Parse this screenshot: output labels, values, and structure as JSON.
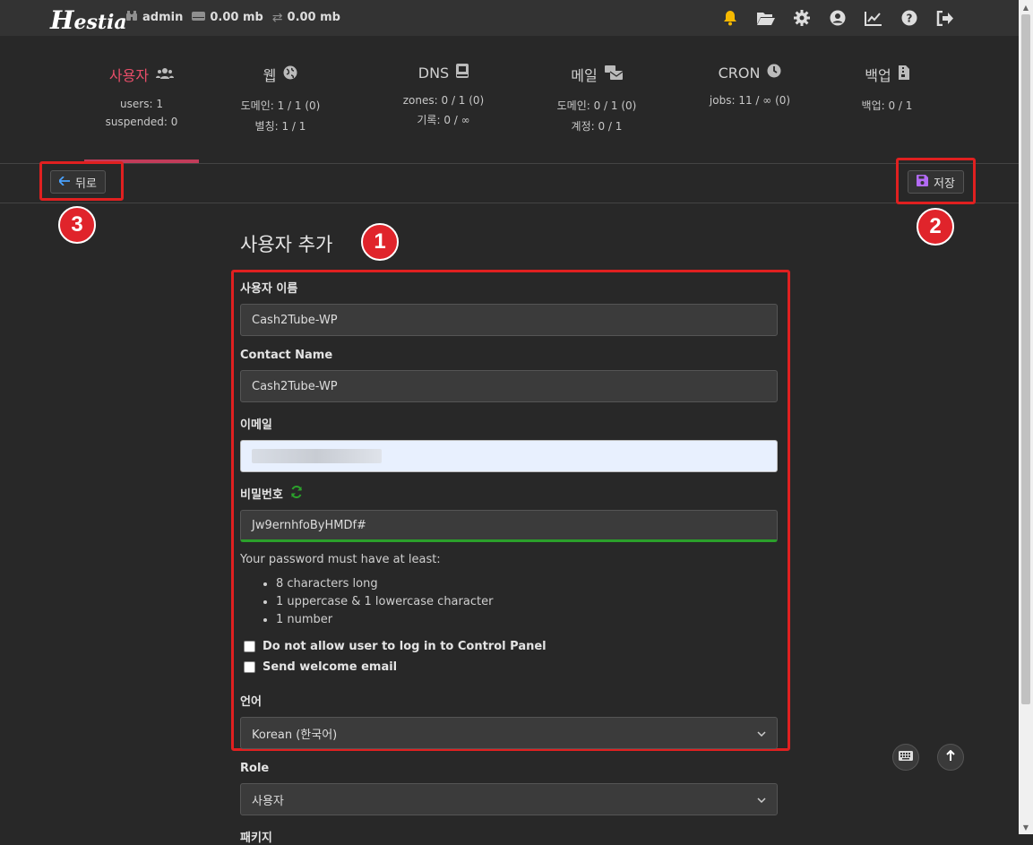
{
  "topbar": {
    "logo": "estia",
    "logo_h": "H",
    "user": "admin",
    "disk": "0.00 mb",
    "bandwidth": "0.00 mb"
  },
  "tabs": [
    {
      "title": "사용자",
      "l1": "users: 1",
      "l2": "suspended: 0",
      "icon": "users-icon"
    },
    {
      "title": "웹",
      "l1": "도메인: 1 / 1 (0)",
      "l2": "별칭: 1 / 1",
      "icon": "globe-icon"
    },
    {
      "title": "DNS",
      "l1": "zones: 0 / 1 (0)",
      "l2": "기록: 0 / ∞",
      "icon": "book-icon"
    },
    {
      "title": "메일",
      "l1": "도메인: 0 / 1 (0)",
      "l2": "계정: 0 / 1",
      "icon": "mail-bulk-icon"
    },
    {
      "title": "CRON",
      "l1": "jobs: 11 / ∞ (0)",
      "l2": "",
      "icon": "clock-icon"
    },
    {
      "title": "백업",
      "l1": "백업: 0 / 1",
      "l2": "",
      "icon": "file-archive-icon"
    }
  ],
  "toolbar": {
    "back_label": "뒤로",
    "save_label": "저장"
  },
  "markers": {
    "m1": "1",
    "m2": "2",
    "m3": "3"
  },
  "form": {
    "title": "사용자 추가",
    "username_label": "사용자 이름",
    "username_value": "Cash2Tube-WP",
    "contact_label": "Contact Name",
    "contact_value": "Cash2Tube-WP",
    "email_label": "이메일",
    "password_label": "비밀번호",
    "password_value": "Jw9ernhfoByHMDf#",
    "pw_info": "Your password must have at least:",
    "pw_rules": [
      "8 characters long",
      "1 uppercase & 1 lowercase character",
      "1 number"
    ],
    "chk_no_login": "Do not allow user to log in to Control Panel",
    "chk_welcome": "Send welcome email",
    "language_label": "언어",
    "language_value": "Korean (한국어)",
    "role_label": "Role",
    "role_value": "사용자",
    "package_label": "패키지"
  },
  "colors": {
    "accent": "#e84e69",
    "marker": "#e0242b",
    "password_ok": "#2ba02b",
    "save_icon": "#b36bf5",
    "back_arrow": "#4aa3ff"
  }
}
